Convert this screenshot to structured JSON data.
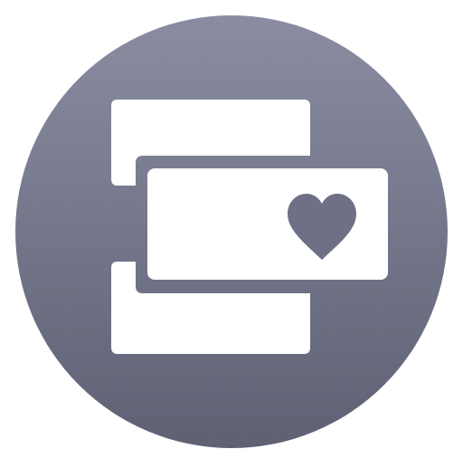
{
  "icon": {
    "name": "app-icon",
    "glyph": "stacked-cards-with-heart-icon",
    "colors": {
      "background_top": "#8A8CA1",
      "background_bottom": "#5E6174",
      "foreground": "#FFFFFF",
      "heart": "#6E7186"
    }
  }
}
